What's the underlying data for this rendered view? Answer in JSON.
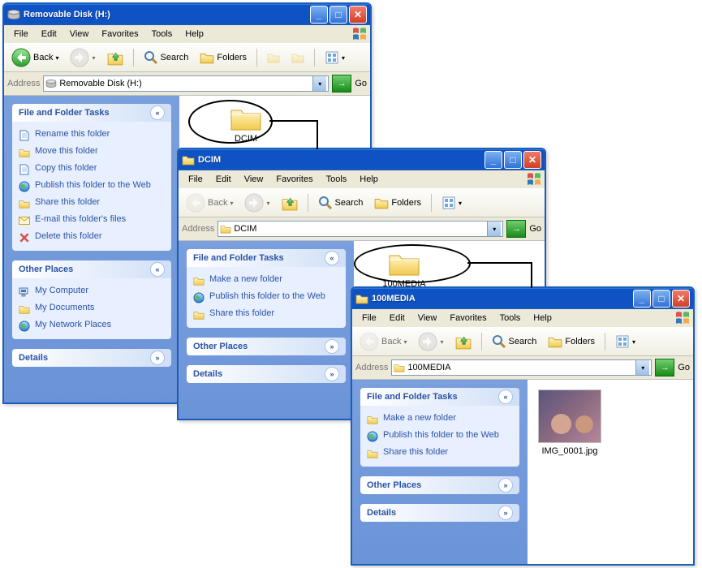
{
  "windows": [
    {
      "key": "w1",
      "title": "Removable Disk (H:)",
      "addr": "Removable Disk (H:)",
      "back_enabled": true,
      "tasks_title": "File and Folder Tasks",
      "tasks": [
        "Rename this folder",
        "Move this folder",
        "Copy this folder",
        "Publish this folder to the Web",
        "Share this folder",
        "E-mail this folder's files",
        "Delete this folder"
      ],
      "other_title": "Other Places",
      "other": [
        "My Computer",
        "My Documents",
        "My Network Places"
      ],
      "details_title": "Details",
      "folder_item": "DCIM"
    },
    {
      "key": "w2",
      "title": "DCIM",
      "addr": "DCIM",
      "back_enabled": false,
      "tasks_title": "File and Folder Tasks",
      "tasks": [
        "Make a new folder",
        "Publish this folder to the Web",
        "Share this folder"
      ],
      "other_title": "Other Places",
      "details_title": "Details",
      "folder_item": "100MEDIA"
    },
    {
      "key": "w3",
      "title": "100MEDIA",
      "addr": "100MEDIA",
      "back_enabled": false,
      "tasks_title": "File and Folder Tasks",
      "tasks": [
        "Make a new folder",
        "Publish this folder to the Web",
        "Share this folder"
      ],
      "other_title": "Other Places",
      "details_title": "Details",
      "image_item": "IMG_0001.jpg"
    }
  ],
  "menus": {
    "file": "File",
    "edit": "Edit",
    "view": "View",
    "favorites": "Favorites",
    "tools": "Tools",
    "help": "Help"
  },
  "toolbar": {
    "back": "Back",
    "search": "Search",
    "folders": "Folders",
    "go": "Go"
  },
  "addr_label": "Address"
}
